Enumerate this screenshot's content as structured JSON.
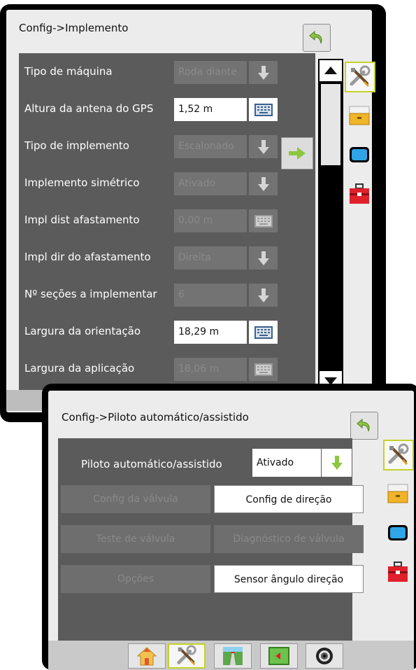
{
  "implement_screen": {
    "title": "Config->Implemento",
    "rows": [
      {
        "label": "Tipo de máquina",
        "value": "Roda diante",
        "control": "dropdown",
        "enabled": false
      },
      {
        "label": "Altura da antena do GPS",
        "value": "1,52 m",
        "control": "keyboard",
        "enabled": true
      },
      {
        "label": "Tipo de implemento",
        "value": "Escalonado",
        "control": "dropdown",
        "enabled": false
      },
      {
        "label": "Implemento simétrico",
        "value": "Ativado",
        "control": "dropdown",
        "enabled": false
      },
      {
        "label": "Impl dist afastamento",
        "value": "0,00 m",
        "control": "keyboard",
        "enabled": false
      },
      {
        "label": "Impl dir do afastamento",
        "value": "Direita",
        "control": "dropdown",
        "enabled": false
      },
      {
        "label": "Nº seções a implementar",
        "value": "6",
        "control": "dropdown",
        "enabled": false
      },
      {
        "label": "Largura da orientação",
        "value": "18,29 m",
        "control": "keyboard",
        "enabled": true
      },
      {
        "label": "Largura da aplicação",
        "value": "18,06 m",
        "control": "keyboard",
        "enabled": false
      }
    ]
  },
  "autopilot_screen": {
    "title": "Config->Piloto automático/assistido",
    "autopilot_label": "Piloto automático/assistido",
    "autopilot_value": "Ativado",
    "buttons": [
      {
        "label": "Config da válvula",
        "enabled": false
      },
      {
        "label": "Config de direção",
        "enabled": true
      },
      {
        "label": "Teste de válvula",
        "enabled": false
      },
      {
        "label": "Diagnóstico de válvula",
        "enabled": false
      },
      {
        "label": "Opções",
        "enabled": false
      },
      {
        "label": "Sensor ângulo direção",
        "enabled": true
      }
    ]
  },
  "side_tabs": [
    "tools-icon",
    "console-icon",
    "display-icon",
    "toolbox-icon"
  ],
  "bottom_nav": [
    "home-icon",
    "tools-icon",
    "guidance-icon",
    "map-icon",
    "camera-icon"
  ],
  "colors": {
    "accent_green": "#8dc63f",
    "active_border": "#c5d12b",
    "panel_gray": "#5b5b5b"
  }
}
